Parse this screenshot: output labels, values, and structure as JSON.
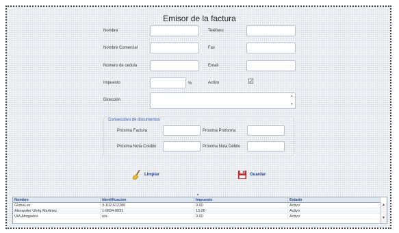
{
  "form": {
    "title": "Emisor de la factura",
    "fields": {
      "nombre": {
        "label": "Nombre",
        "value": ""
      },
      "telefono": {
        "label": "Teléfono",
        "value": ""
      },
      "nombre_comercial": {
        "label": "Nombre Comercial",
        "value": ""
      },
      "fax": {
        "label": "Fax",
        "value": ""
      },
      "numero_cedula": {
        "label": "Número de cedula",
        "value": ""
      },
      "email": {
        "label": "Email",
        "value": ""
      },
      "impuesto": {
        "label": "Impuesto",
        "value": "",
        "suffix": "%"
      },
      "activo": {
        "label": "Activo",
        "checked": true
      },
      "direccion": {
        "label": "Dirección",
        "value": ""
      }
    },
    "consecutivo": {
      "title": "Consecutivo de documentos",
      "proxima_factura": {
        "label": "Próxima Factura",
        "value": ""
      },
      "proxima_proforma": {
        "label": "Próxima Proforma",
        "value": ""
      },
      "proxima_nota_credito": {
        "label": "Próxima Nota Crédito",
        "value": ""
      },
      "proxima_nota_debito": {
        "label": "Próxima Nota Débito",
        "value": ""
      }
    },
    "buttons": {
      "limpiar": {
        "label": "Limpiar",
        "icon": "broom-icon"
      },
      "guardar": {
        "label": "Guardar",
        "icon": "floppy-disk-icon"
      }
    }
  },
  "grid": {
    "columns": [
      "Nombre",
      "Identificacion",
      "Impuesto",
      "Estado"
    ],
    "rows": [
      [
        "GlobaLex",
        "3-102-612286",
        "0.00",
        "Activo"
      ],
      [
        "Alexander Uhrig Martinez",
        "1-0834-0031",
        "13.00",
        "Activo"
      ],
      [
        "UIA Abogados",
        "n/a",
        "0.00",
        "Activo"
      ]
    ]
  },
  "colors": {
    "link_blue": "#1d3e8a",
    "group_title": "#2b4fa0",
    "header_bg": "#dfe7f0"
  }
}
